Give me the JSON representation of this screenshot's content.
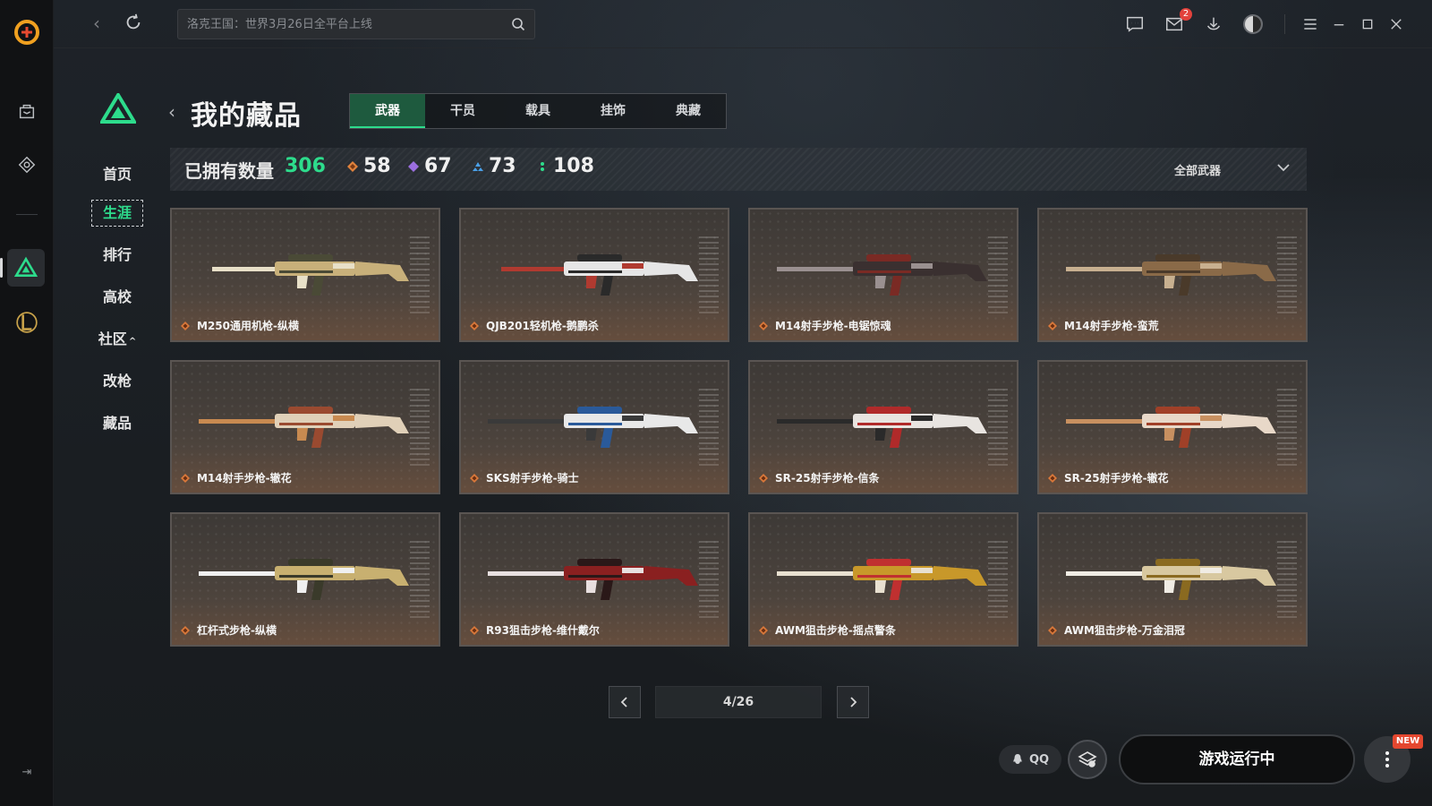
{
  "window": {
    "search_placeholder": "洛克王国：世界3月26日全平台上线",
    "mail_badge": "2",
    "icons": [
      "chat-icon",
      "mail-icon",
      "download-icon",
      "avatar",
      "menu-icon",
      "minimize-icon",
      "maximize-icon",
      "close-icon"
    ]
  },
  "rail": {
    "icons": [
      "app-logo-icon",
      "bag-icon",
      "game-tag-icon",
      "delta-force-icon",
      "league-of-legends-icon",
      "collapse-icon"
    ]
  },
  "side_nav": {
    "items": [
      {
        "label": "首页",
        "active": false
      },
      {
        "label": "生涯",
        "active": true
      },
      {
        "label": "排行",
        "active": false
      },
      {
        "label": "高校",
        "active": false
      },
      {
        "label": "社区",
        "active": false,
        "chevron": "^"
      },
      {
        "label": "改枪",
        "active": false
      },
      {
        "label": "藏品",
        "active": false
      }
    ]
  },
  "page": {
    "title": "我的藏品",
    "tabs": [
      {
        "label": "武器",
        "active": true
      },
      {
        "label": "干员",
        "active": false
      },
      {
        "label": "载具",
        "active": false
      },
      {
        "label": "挂饰",
        "active": false
      },
      {
        "label": "典藏",
        "active": false
      }
    ]
  },
  "summary": {
    "label": "已拥有数量",
    "total": "306",
    "counts": [
      {
        "value": "58",
        "color": "#e0823c"
      },
      {
        "value": "67",
        "color": "#9b6ee0"
      },
      {
        "value": "73",
        "color": "#4aa0e8"
      },
      {
        "value": "108",
        "color": "#2ddc8c"
      }
    ],
    "filter": "全部武器"
  },
  "weapons": [
    {
      "name": "M250通用机枪-纵横",
      "palette": [
        "#c8b07a",
        "#4a4a36",
        "#e8e0c8"
      ]
    },
    {
      "name": "QJB201轻机枪-鹅鹏杀",
      "palette": [
        "#e6e6e6",
        "#2a2a2a",
        "#b03a30"
      ]
    },
    {
      "name": "M14射手步枪-电锯惊魂",
      "palette": [
        "#3a3030",
        "#7a2a24",
        "#9a9090"
      ]
    },
    {
      "name": "M14射手步枪-蛮荒",
      "palette": [
        "#8a6a48",
        "#4a3a2a",
        "#c8b090"
      ]
    },
    {
      "name": "M14射手步枪-辙花",
      "palette": [
        "#e0d0b8",
        "#9a4a30",
        "#c88a50"
      ]
    },
    {
      "name": "SKS射手步枪-骑士",
      "palette": [
        "#e8e8e8",
        "#2a5a9a",
        "#3a3a3a"
      ]
    },
    {
      "name": "SR-25射手步枪-信条",
      "palette": [
        "#e8e4e0",
        "#b02a2a",
        "#2a2a2a"
      ]
    },
    {
      "name": "SR-25射手步枪-辙花",
      "palette": [
        "#e8d8c8",
        "#a04028",
        "#c89060"
      ]
    },
    {
      "name": "杠杆式步枪-纵横",
      "palette": [
        "#c8b070",
        "#3a3a2a",
        "#f0f0f0"
      ]
    },
    {
      "name": "R93狙击步枪-维什戴尔",
      "palette": [
        "#8a2020",
        "#2a1818",
        "#e8e0e0"
      ]
    },
    {
      "name": "AWM狙击步枪-摇点警条",
      "palette": [
        "#c8982a",
        "#c03030",
        "#e8e0d0"
      ]
    },
    {
      "name": "AWM狙击步枪-万金泪冠",
      "palette": [
        "#d8c8a0",
        "#8a6a20",
        "#f0ece4"
      ]
    }
  ],
  "pagination": {
    "current": "4/26"
  },
  "bottom": {
    "qq_label": "QQ",
    "game_status": "游戏运行中",
    "new_tag": "NEW"
  }
}
